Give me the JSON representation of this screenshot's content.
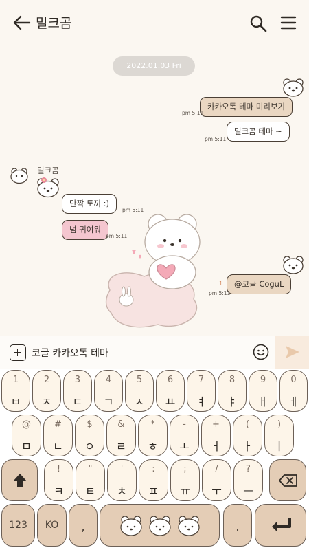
{
  "header": {
    "title": "밀크곰"
  },
  "chat": {
    "date": "2022.01.03 Fri",
    "messages": [
      {
        "text": "카카오톡 테마 미리보기",
        "time": "pm 5:11"
      },
      {
        "text": "밀크곰 테마 ~",
        "time": "pm 5:11"
      },
      {
        "text": "단짝 토끼 :)",
        "time": "pm 5:11"
      },
      {
        "text": "넘 귀여워",
        "time": "pm 5:11"
      },
      {
        "text": "@코글 CoguL",
        "time": "pm 5:11",
        "unread": "1"
      }
    ],
    "sender_name": "밀크곰"
  },
  "input": {
    "text": "코글 카카오톡 테마"
  },
  "keyboard": {
    "row1": [
      {
        "top": "1",
        "main": "ㅂ"
      },
      {
        "top": "2",
        "main": "ㅈ"
      },
      {
        "top": "3",
        "main": "ㄷ"
      },
      {
        "top": "4",
        "main": "ㄱ"
      },
      {
        "top": "5",
        "main": "ㅅ"
      },
      {
        "top": "6",
        "main": "ㅛ"
      },
      {
        "top": "7",
        "main": "ㅕ"
      },
      {
        "top": "8",
        "main": "ㅑ"
      },
      {
        "top": "9",
        "main": "ㅐ"
      },
      {
        "top": "0",
        "main": "ㅔ"
      }
    ],
    "row2": [
      {
        "top": "@",
        "main": "ㅁ"
      },
      {
        "top": "#",
        "main": "ㄴ"
      },
      {
        "top": "$",
        "main": "ㅇ"
      },
      {
        "top": "&",
        "main": "ㄹ"
      },
      {
        "top": "*",
        "main": "ㅎ"
      },
      {
        "top": "-",
        "main": "ㅗ"
      },
      {
        "top": "+",
        "main": "ㅓ"
      },
      {
        "top": "(",
        "main": "ㅏ"
      },
      {
        "top": ")",
        "main": "ㅣ"
      }
    ],
    "row3": [
      {
        "top": "!",
        "main": "ㅋ"
      },
      {
        "top": "\"",
        "main": "ㅌ"
      },
      {
        "top": "'",
        "main": "ㅊ"
      },
      {
        "top": ":",
        "main": "ㅍ"
      },
      {
        "top": ";",
        "main": "ㅠ"
      },
      {
        "top": "/",
        "main": "ㅜ"
      },
      {
        "top": "?",
        "main": "ㅡ"
      }
    ],
    "num_key": "123",
    "lang_key": "KO",
    "comma_key": ",",
    "period_key": "."
  },
  "colors": {
    "accent_tan": "#e4cdb6",
    "bubble_pink": "#f4c6cf",
    "background": "#fbf7f1"
  }
}
